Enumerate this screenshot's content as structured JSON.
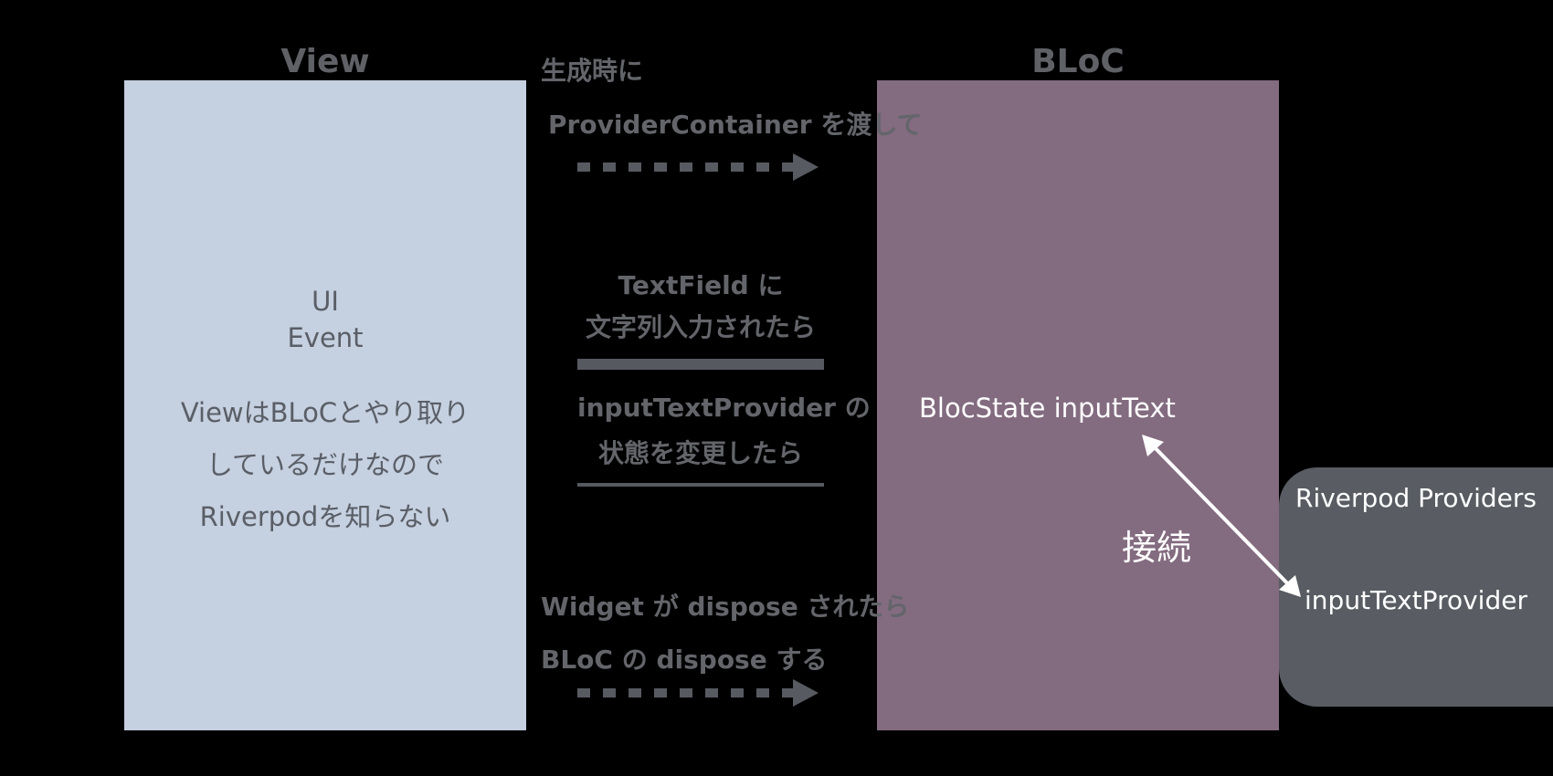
{
  "view": {
    "heading": "View",
    "line1": "UI",
    "line2": "Event",
    "note1": "ViewはBLoCとやり取り",
    "note2": "しているだけなので",
    "note3": "Riverpodを知らない"
  },
  "bloc": {
    "heading": "BLoC",
    "state_label": "BlocState inputText"
  },
  "riverpod": {
    "title": "Riverpod Providers",
    "provider": "inputTextProvider"
  },
  "connection_label": "接続",
  "middle": {
    "top_title": "生成時に",
    "top_sub": "ProviderContainer を渡して",
    "center1": "TextField に",
    "center2": "文字列入力されたら",
    "center3": "inputTextProvider の",
    "center4": "状態を変更したら",
    "bottom1": "Widget が dispose されたら",
    "bottom2": "BLoC の dispose する"
  },
  "colors": {
    "view": "#c5d0e0",
    "bloc": "#836b80",
    "riverpod": "#595d63",
    "background": "#000000"
  }
}
